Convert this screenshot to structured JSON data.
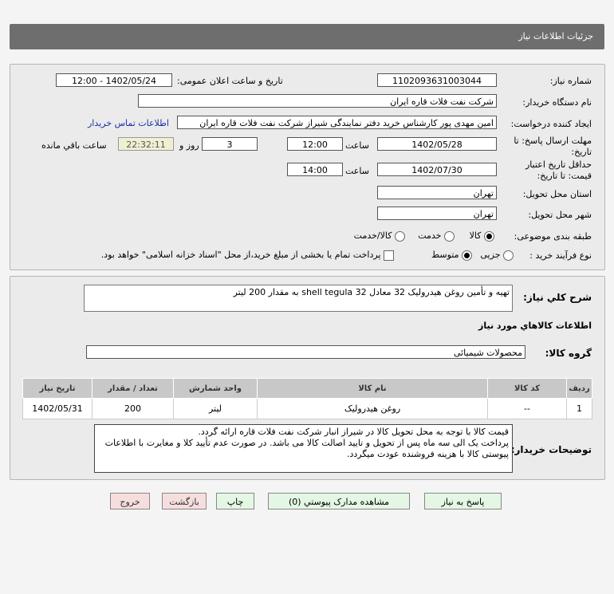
{
  "header": {
    "title": "جزئیات اطلاعات نیاز"
  },
  "form": {
    "need_number_label": "شماره نیاز:",
    "need_number": "1102093631003044",
    "announce_label": "تاریخ و ساعت اعلان عمومی:",
    "announce_value": "1402/05/24 - 12:00",
    "buyer_label": "نام دستگاه خریدار:",
    "buyer_value": "شرکت نفت فلات قاره ایران",
    "creator_label": "ایجاد کننده درخواست:",
    "creator_value": "امین مهدی پور کارشناس خرید دفتر نمایندگی شیراز شرکت نفت فلات قاره ایران",
    "contact_link": "اطلاعات تماس خریدار",
    "deadline_label": "مهلت ارسال پاسخ: تا تاریخ:",
    "deadline_date": "1402/05/28",
    "hour_label": "ساعت",
    "deadline_time": "12:00",
    "days": "3",
    "days_label": "روز و",
    "remaining": "22:32:11",
    "remaining_label": "ساعت باقي مانده",
    "validity_label": "حداقل تاریخ اعتبار قیمت: تا تاریخ:",
    "validity_date": "1402/07/30",
    "validity_time": "14:00",
    "province_label": "استان محل تحویل:",
    "province": "تهران",
    "city_label": "شهر محل تحویل:",
    "city": "تهران",
    "category_label": "طبقه بندی موضوعی:",
    "category_options": [
      "کالا",
      "خدمت",
      "کالا/خدمت"
    ],
    "category_selected": "کالا",
    "process_label": "نوع فرآیند خرید :",
    "process_options": [
      "جزیی",
      "متوسط"
    ],
    "process_selected": "متوسط",
    "payment_note": "پرداخت تمام یا بخشی از مبلغ خرید،از محل \"اسناد خزانه اسلامی\" خواهد بود."
  },
  "details": {
    "desc_label": "شرح کلي نیاز:",
    "desc": "تهیه و تأمین روغن هیدرولیک 32 معادل shell tegula 32 به مقدار 200 لیتر",
    "goods_title": "اطلاعات کالاهاي مورد نیاز",
    "group_label": "گروه کالا:",
    "group": "محصولات شیمیائی",
    "table": {
      "headers": [
        "ردیف",
        "کد کالا",
        "نام کالا",
        "واحد شمارش",
        "تعداد / مقدار",
        "تاریخ نیاز"
      ],
      "rows": [
        [
          "1",
          "--",
          "روغن هیدرولیک",
          "لیتر",
          "200",
          "1402/05/31"
        ]
      ]
    },
    "notes_label": "توضیحات خریدار:",
    "notes": [
      "قیمت کالا با توجه به محل تحویل کالا در شیراز انبار شرکت نفت فلات قاره ارائه گردد.",
      "پرداخت یک الی سه ماه پس از تحویل و تایید اصالت کالا می باشد. در صورت عدم تأیید کلا و مغایرت با اطلاعات پیوستی کالا با هزینه فروشنده عودت میگردد."
    ]
  },
  "buttons": {
    "reply": "پاسخ به نیاز",
    "attachments": "مشاهده مدارک پیوستي (0)",
    "print": "چاپ",
    "back": "بازگشت",
    "exit": "خروج"
  }
}
